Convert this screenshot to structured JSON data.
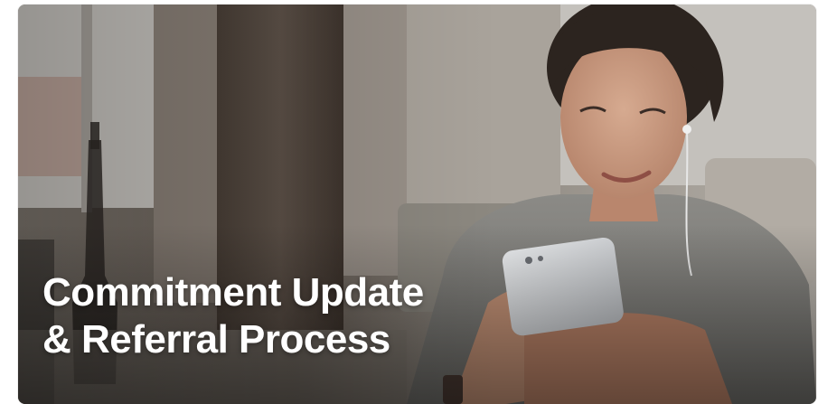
{
  "card": {
    "title_line_1": "Commitment Update",
    "title_line_2": "& Referral Process",
    "image_subject": "woman-smiling-at-smartphone-with-earphones"
  },
  "colors": {
    "title_text": "#ffffff",
    "scene_wall": "#a7a29a",
    "curtain": "#5a4e45",
    "shirt": "#7d7c78",
    "skin": "#c99a80",
    "hair": "#2c241f",
    "phone": "#d9dbdd"
  }
}
